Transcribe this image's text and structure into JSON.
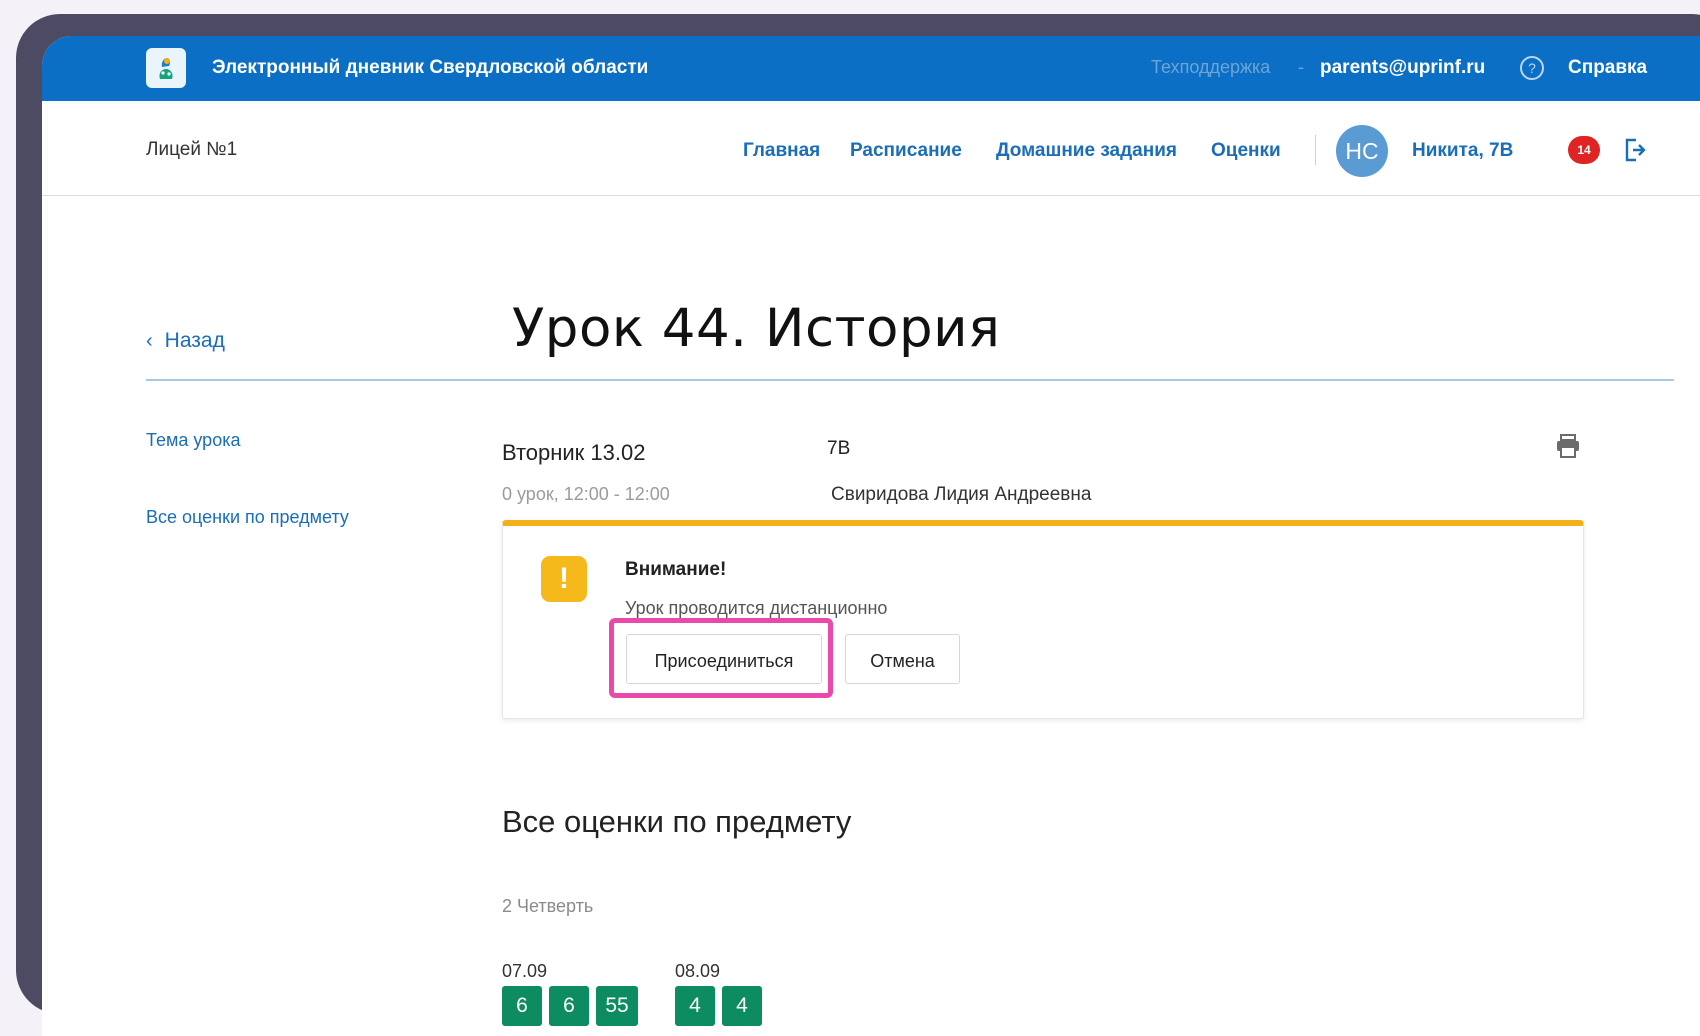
{
  "header": {
    "app_title": "Электронный дневник Свердловской области",
    "support_label": "Техподдержка",
    "support_separator": "-",
    "support_email": "parents@uprinf.ru",
    "help_label": "Справка"
  },
  "nav": {
    "school": "Лицей №1",
    "items": [
      "Главная",
      "Расписание",
      "Домашние задания",
      "Оценки"
    ],
    "avatar_initials": "НС",
    "user_name": "Никита, 7В",
    "notifications_count": "14"
  },
  "lesson": {
    "back_label": "Назад",
    "title": "Урок 44. История",
    "date": "Вторник 13.02",
    "class_name": "7В",
    "lesson_time": "0 урок,   12:00 - 12:00",
    "teacher": "Свиридова Лидия Андреевна"
  },
  "sidebar": {
    "links": [
      "Тема урока",
      "Все оценки по предмету"
    ]
  },
  "alert": {
    "icon_symbol": "!",
    "title": "Внимание!",
    "text": "Урок проводится дистанционно",
    "join_label": "Присоединиться",
    "cancel_label": "Отмена"
  },
  "grades": {
    "section_title": "Все оценки по предмету",
    "term": "2 Четверть",
    "groups": [
      {
        "date": "07.09",
        "marks": [
          "6",
          "6",
          "55"
        ]
      },
      {
        "date": "08.09",
        "marks": [
          "4",
          "4"
        ]
      }
    ]
  },
  "colors": {
    "header_blue": "#0b6fc6",
    "link_blue": "#1a6db8",
    "warning_yellow": "#f5b91b",
    "grade_green": "#0e8c61",
    "highlight_pink": "#e94aa9",
    "badge_red": "#e02424"
  },
  "icons": {
    "logo": "region-logo-icon",
    "help": "question-circle-icon",
    "logout": "logout-icon",
    "print": "printer-icon",
    "back": "chevron-left-icon",
    "warning": "exclamation-icon"
  }
}
